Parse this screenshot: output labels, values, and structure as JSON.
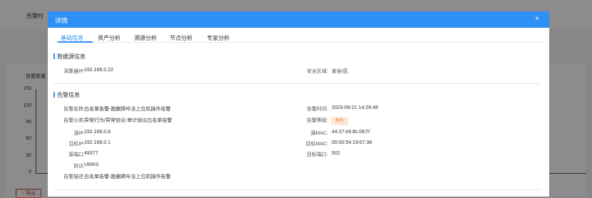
{
  "background": {
    "filter_label": "告警时",
    "chart_title": "告警数量",
    "y_ticks": [
      "150",
      "120",
      "90",
      "60",
      "30",
      "0"
    ],
    "export_label": "导出"
  },
  "modal": {
    "title": "详情",
    "close_icon": "×",
    "tabs": [
      {
        "label": "基础信息",
        "active": true
      },
      {
        "label": "资产分析",
        "active": false
      },
      {
        "label": "溯源分析",
        "active": false
      },
      {
        "label": "节点分析",
        "active": false
      },
      {
        "label": "专家分析",
        "active": false
      }
    ],
    "source_section": {
      "title": "数据源信息",
      "collector_ip_label": "采集器IP:",
      "collector_ip": "192.168.0.22",
      "zone_label": "安全区域:",
      "zone": "安全Ⅰ区"
    },
    "alarm_section": {
      "title": "告警信息",
      "fields_left": [
        {
          "label": "告警名称:",
          "value": "白名单告警-跑删捧咔法上位机操作告警"
        },
        {
          "label": "告警分类:",
          "value": "异常行为/异常协议-审计协议白名单告警"
        },
        {
          "label": "源IP:",
          "value": "192.168.0.8"
        },
        {
          "label": "目标IP:",
          "value": "192.168.0.1"
        },
        {
          "label": "源端口:",
          "value": "49377"
        },
        {
          "label": "协议:",
          "value": "UMAS"
        },
        {
          "label": "告警描述:",
          "value": "白名单告警-跑删捧咔法上位机操作告警"
        }
      ],
      "fields_right": [
        {
          "label": "告警时间:",
          "value": "2023-09-21 14:28:48"
        },
        {
          "label": "告警等级:",
          "value": "高危"
        },
        {
          "label": "源MAC:",
          "value": "44:37:e6:8c:08:f7"
        },
        {
          "label": "目标MAC:",
          "value": "00:00:54:19:67:38"
        },
        {
          "label": "目标端口:",
          "value": "502"
        }
      ]
    },
    "colors": {
      "primary": "#2e8ff5",
      "danger_bg": "#fde9dc",
      "danger_text": "#f0833a"
    }
  }
}
